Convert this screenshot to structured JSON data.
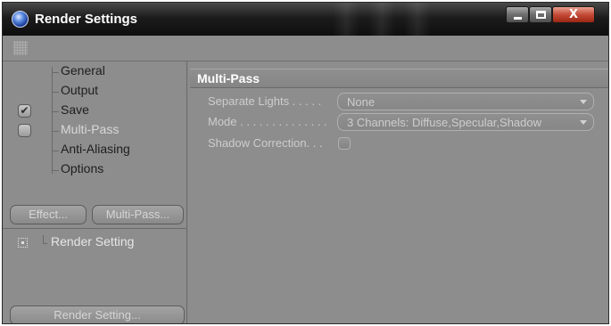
{
  "window": {
    "title": "Render Settings",
    "controls": {
      "minimize": "minimize",
      "maximize": "maximize",
      "close": "X"
    }
  },
  "sidebar": {
    "tree": [
      {
        "label": "General",
        "checkbox": null
      },
      {
        "label": "Output",
        "checkbox": null
      },
      {
        "label": "Save",
        "checkbox": "checked",
        "check_glyph": "✔"
      },
      {
        "label": "Multi-Pass",
        "checkbox": "unchecked"
      },
      {
        "label": "Anti-Aliasing",
        "checkbox": null
      },
      {
        "label": "Options",
        "checkbox": null
      }
    ],
    "effect_button": "Effect...",
    "multipass_button": "Multi-Pass...",
    "render_settings_list": [
      {
        "label": "Render Setting"
      }
    ],
    "render_setting_button": "Render Setting..."
  },
  "panel": {
    "section_title": "Multi-Pass",
    "params": {
      "separate_lights": {
        "label": "Separate Lights . . . . .",
        "value": "None"
      },
      "mode": {
        "label": "Mode . . . . . . . . . . . . . .",
        "value": "3 Channels: Diffuse,Specular,Shadow"
      },
      "shadow_correction": {
        "label": "Shadow Correction. . .",
        "checked": false
      }
    }
  },
  "colors": {
    "panel_bg": "#8d8d8d",
    "titlebar": "#141414",
    "close_button": "#c44a36"
  }
}
